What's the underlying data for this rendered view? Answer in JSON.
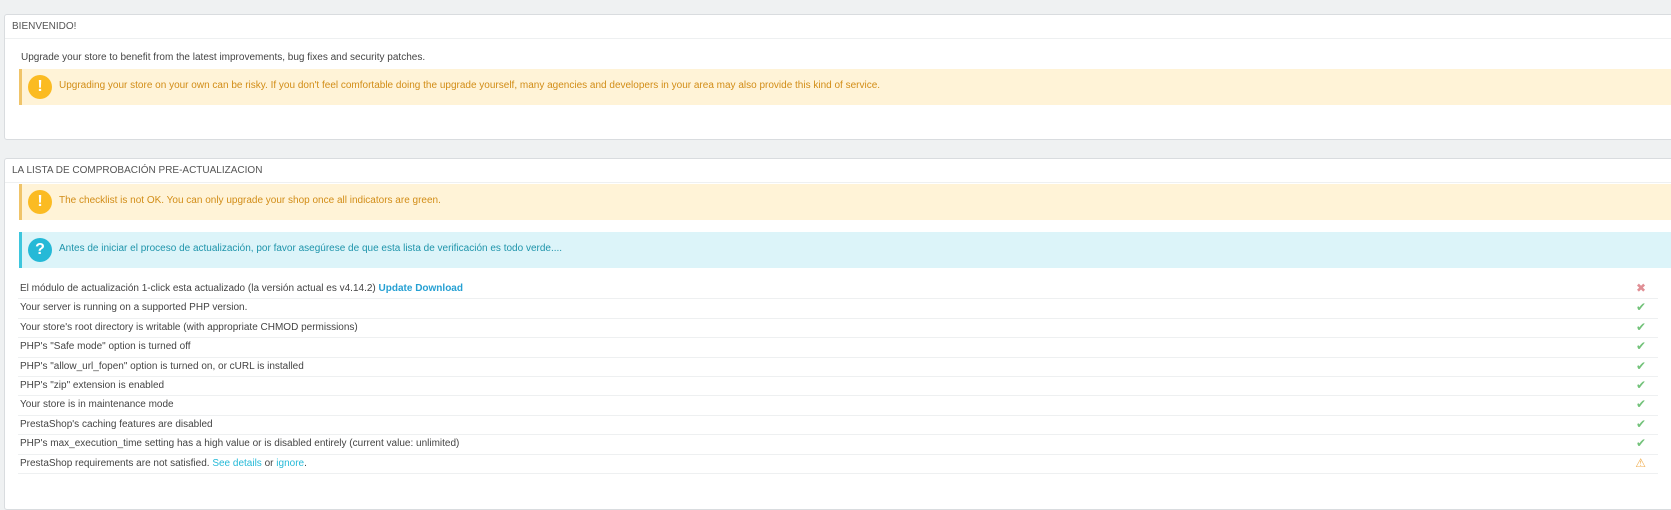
{
  "welcome": {
    "heading": "BIENVENIDO!",
    "intro": "Upgrade your store to benefit from the latest improvements, bug fixes and security patches.",
    "warning": "Upgrading your store on your own can be risky. If you don't feel comfortable doing the upgrade yourself, many agencies and developers in your area may also provide this kind of service."
  },
  "checklist": {
    "heading": "LA LISTA DE COMPROBACIÓN PRE-ACTUALIZACION",
    "warning": "The checklist is not OK. You can only upgrade your shop once all indicators are green.",
    "info": "Antes de iniciar el proceso de actualización, por favor asegúrese de que esta lista de verificación es todo verde....",
    "items": [
      {
        "label": "El módulo de actualización 1-click esta actualizado (la versión actual es v4.14.2)",
        "link": "Update Download",
        "status": "fail"
      },
      {
        "label": "Your server is running on a supported PHP version.",
        "status": "ok"
      },
      {
        "label": "Your store's root directory is writable (with appropriate CHMOD permissions)",
        "status": "ok"
      },
      {
        "label": "PHP's \"Safe mode\" option is turned off",
        "status": "ok"
      },
      {
        "label": "PHP's \"allow_url_fopen\" option is turned on, or cURL is installed",
        "status": "ok"
      },
      {
        "label": "PHP's \"zip\" extension is enabled",
        "status": "ok"
      },
      {
        "label": "Your store is in maintenance mode",
        "status": "ok"
      },
      {
        "label": "PrestaShop's caching features are disabled",
        "status": "ok"
      },
      {
        "label": "PHP's max_execution_time setting has a high value or is disabled entirely (current value: unlimited)",
        "status": "ok"
      },
      {
        "label": "PrestaShop requirements are not satisfied.",
        "link": "See details",
        "conj": "or",
        "link2": "ignore",
        "status": "warning"
      }
    ]
  },
  "icons": {
    "warning": "exclamation-circle-icon",
    "info": "question-circle-icon",
    "ok": "check-icon",
    "fail": "cross-icon",
    "warn": "warning-triangle-icon"
  }
}
